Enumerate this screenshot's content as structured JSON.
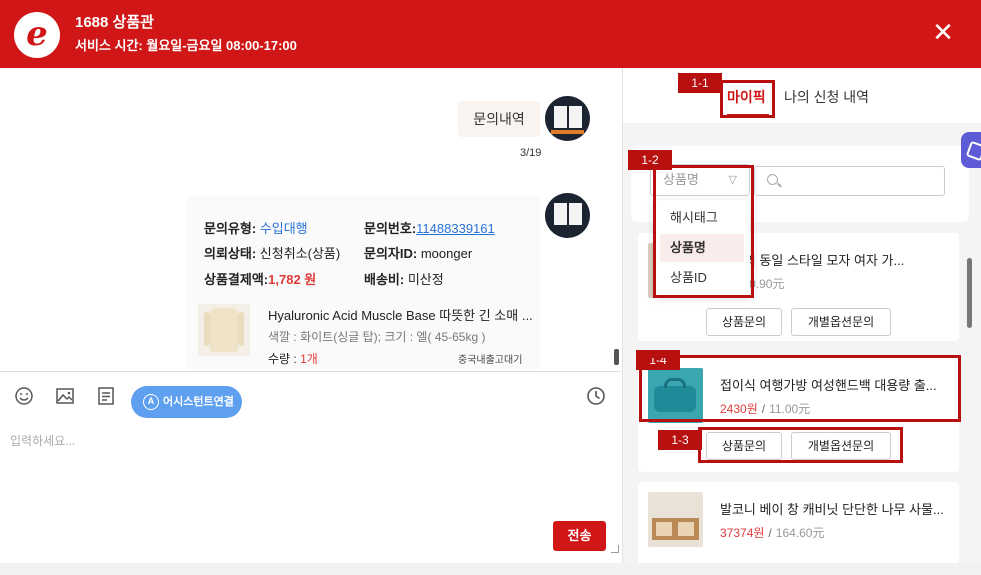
{
  "header": {
    "logo_letter": "e",
    "title": "1688 상품관",
    "subtitle": "서비스 시간: 월요일-금요일 08:00-17:00",
    "close_label": "✕"
  },
  "chat": {
    "bubble_text": "문의내역",
    "pager": "3/19",
    "card": {
      "type_label": "문의유형:",
      "type_value": "수입대행",
      "number_label": "문의번호:",
      "number_value": "11488339161",
      "status_label": "의뢰상태:",
      "status_value": "신청취소(상품)",
      "user_label": "문의자ID:",
      "user_value": "moonger",
      "amount_label": "상품결제액:",
      "amount_value": "1,782 원",
      "shipping_label": "배송비:",
      "shipping_value": "미산정",
      "product_title": "Hyaluronic Acid Muscle Base 따뜻한 긴 소매 ...",
      "product_option": "색깔 : 화이트(싱글 탑);  크기 : 엘( 45-65kg )",
      "qty_label": "수량  : ",
      "qty_value": "1개",
      "ship_from": "중국내출고대기"
    }
  },
  "composer": {
    "assistant_button": "어시스턴트연결",
    "assistant_icon_text": "A",
    "placeholder": "입력하세요...",
    "send_label": "전송",
    "icons": [
      "emoji-icon",
      "image-icon",
      "document-icon",
      "clock-icon"
    ]
  },
  "right": {
    "tabs": [
      {
        "label": "마이픽",
        "active": true
      },
      {
        "label": "나의 신청 내역",
        "active": false
      }
    ],
    "select_value": "상품명",
    "dropdown_options": [
      {
        "label": "해시태그",
        "selected": false
      },
      {
        "label": "상품명",
        "selected": true
      },
      {
        "label": "상품ID",
        "selected": false
      }
    ],
    "products": [
      {
        "title": "uxin의 동일 스타일 모자 여자 가...",
        "krw": "원",
        "cny": "10.90元"
      },
      {
        "title": "접이식 여행가방 여성핸드백 대용량 출...",
        "krw": "2430원",
        "cny": "11.00元"
      },
      {
        "title": "발코니 베이 창 캐비닛 단단한 나무 사물...",
        "krw": "37374원",
        "cny": "164.60元"
      }
    ],
    "btn_inquiry": "상품문의",
    "btn_option_inquiry": "개별옵션문의",
    "price_sep": "/"
  },
  "annotations": [
    "1-1",
    "1-2",
    "1-3",
    "1-4"
  ],
  "colors": {
    "brand_red": "#d01616",
    "annotation_red": "#b80f0f",
    "link_blue": "#2a73d9",
    "assistant_blue": "#5ea0ef",
    "price_red": "#e03b3b"
  }
}
